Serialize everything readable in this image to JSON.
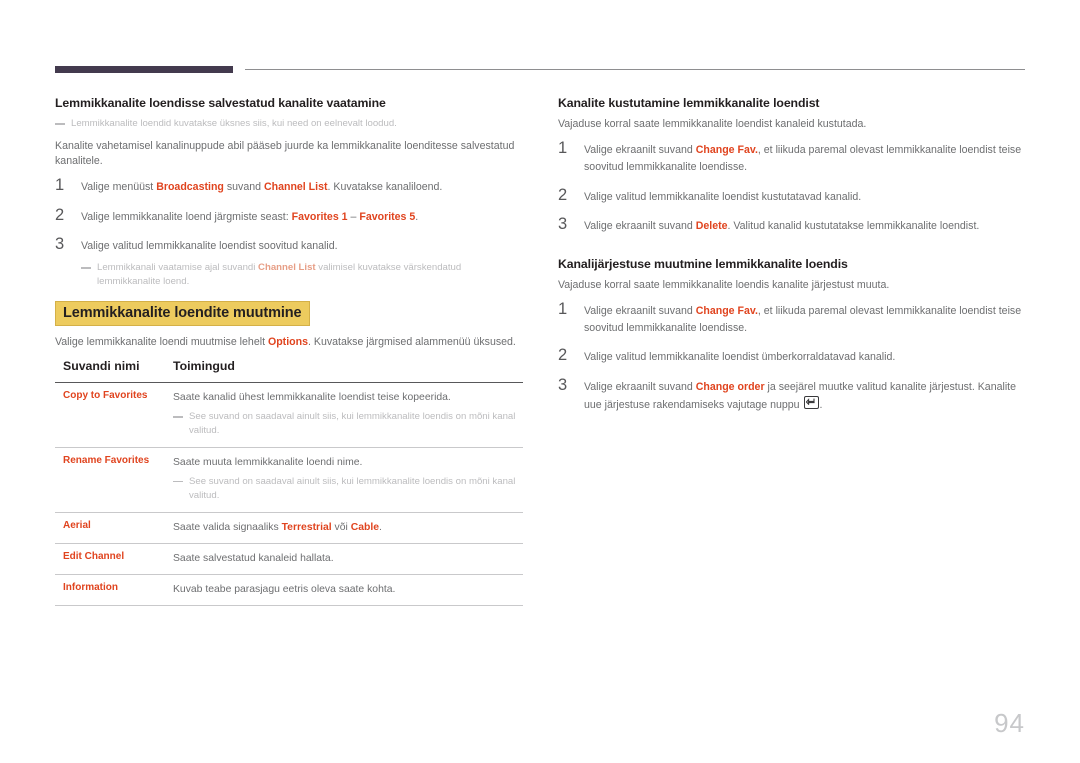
{
  "page": {
    "number": "94",
    "accent_color": "#e0441f",
    "rule_color": "#433a4e",
    "highlight_color": "#edcb5e"
  },
  "left_column": {
    "section1": {
      "title": "Lemmikkanalite loendisse salvestatud kanalite vaatamine",
      "note": "Lemmikkanalite loendid kuvatakse üksnes siis, kui need on eelnevalt loodud.",
      "intro": "Kanalite vahetamisel kanalinuppude abil pääseb juurde ka lemmikkanalite loenditesse salvestatud kanalitele.",
      "steps": [
        {
          "num": "1",
          "text_before": "Valige menüüst ",
          "accent1": "Broadcasting",
          "text_mid": " suvand ",
          "accent2": "Channel List",
          "text_after": ". Kuvatakse kanaliloend."
        },
        {
          "num": "2",
          "text_before": "Valige lemmikkanalite loend järgmiste seast: ",
          "accent1": "Favorites 1",
          "text_mid": " – ",
          "accent2": "Favorites 5",
          "text_after": "."
        },
        {
          "num": "3",
          "text_before": "Valige valitud lemmikkanalite loendist soovitud kanalid.",
          "note_before": "Lemmikkanali vaatamise ajal suvandi ",
          "note_accent": "Channel List",
          "note_after": " valimisel kuvatakse värskendatud lemmikkanalite loend."
        }
      ]
    },
    "section2": {
      "title": "Lemmikkanalite loendite muutmine",
      "intro_before": "Valige lemmikkanalite loendi muutmise lehelt ",
      "intro_accent": "Options",
      "intro_after": ". Kuvatakse järgmised alammenüü üksused.",
      "table": {
        "headers": [
          "Suvandi nimi",
          "Toimingud"
        ],
        "rows": [
          {
            "name": "Copy to Favorites",
            "desc": "Saate kanalid ühest lemmikkanalite loendist teise kopeerida.",
            "note": "See suvand on saadaval ainult siis, kui lemmikkanalite loendis on mõni kanal valitud."
          },
          {
            "name": "Rename Favorites",
            "desc": "Saate muuta lemmikkanalite loendi nime.",
            "note": "See suvand on saadaval ainult siis, kui lemmikkanalite loendis on mõni kanal valitud."
          },
          {
            "name": "Aerial",
            "desc_before": "Saate valida signaaliks ",
            "desc_accent1": "Terrestrial",
            "desc_mid": " või ",
            "desc_accent2": "Cable",
            "desc_after": ".",
            "note": ""
          },
          {
            "name": "Edit Channel",
            "desc": "Saate salvestatud kanaleid hallata.",
            "note": ""
          },
          {
            "name": "Information",
            "desc": "Kuvab teabe parasjagu eetris oleva saate kohta.",
            "note": ""
          }
        ]
      }
    }
  },
  "right_column": {
    "section1": {
      "title": "Kanalite kustutamine lemmikkanalite loendist",
      "intro": "Vajaduse korral saate lemmikkanalite loendist kanaleid kustutada.",
      "steps": [
        {
          "num": "1",
          "text_before": "Valige ekraanilt suvand ",
          "accent1": "Change Fav.",
          "text_after": ", et liikuda paremal olevast lemmikkanalite loendist teise soovitud lemmikkanalite loendisse."
        },
        {
          "num": "2",
          "text_before": "Valige valitud lemmikkanalite loendist kustutatavad kanalid."
        },
        {
          "num": "3",
          "text_before": "Valige ekraanilt suvand ",
          "accent1": "Delete",
          "text_after": ". Valitud kanalid kustutatakse lemmikkanalite loendist."
        }
      ]
    },
    "section2": {
      "title": "Kanalijärjestuse muutmine lemmikkanalite loendis",
      "intro": "Vajaduse korral saate lemmikkanalite loendis kanalite järjestust muuta.",
      "steps": [
        {
          "num": "1",
          "text_before": "Valige ekraanilt suvand ",
          "accent1": "Change Fav.",
          "text_after": ", et liikuda paremal olevast lemmikkanalite loendist teise soovitud lemmikkanalite loendisse."
        },
        {
          "num": "2",
          "text_before": "Valige valitud lemmikkanalite loendist ümberkorraldatavad kanalid."
        },
        {
          "num": "3",
          "text_before": "Valige ekraanilt suvand ",
          "accent1": "Change order",
          "text_after": " ja seejärel muutke valitud kanalite järjestust. Kanalite uue järjestuse rakendamiseks vajutage nuppu ",
          "icon": "enter-key-icon",
          "text_end": "."
        }
      ]
    }
  }
}
